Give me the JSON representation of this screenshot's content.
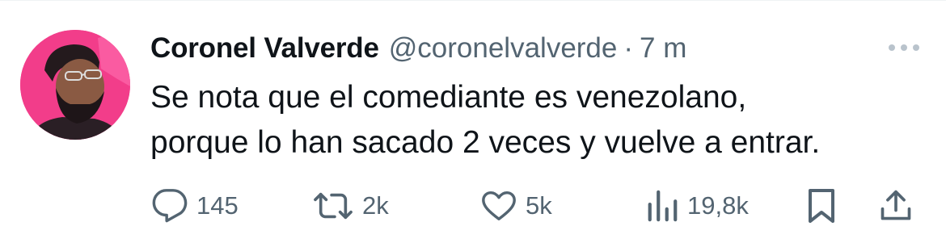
{
  "author": {
    "name": "Coronel Valverde",
    "handle": "@coronelvalverde",
    "separator": "·",
    "time": "7 m",
    "avatar_bg": "#f23d8a"
  },
  "tweet": {
    "lines": [
      "Se nota que el comediante es venezolano,",
      "porque lo han sacado 2 veces y vuelve a entrar."
    ]
  },
  "actions": {
    "reply": {
      "icon": "reply-icon",
      "count": "145"
    },
    "retweet": {
      "icon": "retweet-icon",
      "count": "2k"
    },
    "like": {
      "icon": "heart-icon",
      "count": "5k"
    },
    "views": {
      "icon": "views-icon",
      "count": "19,8k"
    },
    "bookmark": {
      "icon": "bookmark-icon"
    },
    "share": {
      "icon": "share-icon"
    }
  },
  "colors": {
    "text": "#0f1419",
    "secondary": "#536471"
  }
}
